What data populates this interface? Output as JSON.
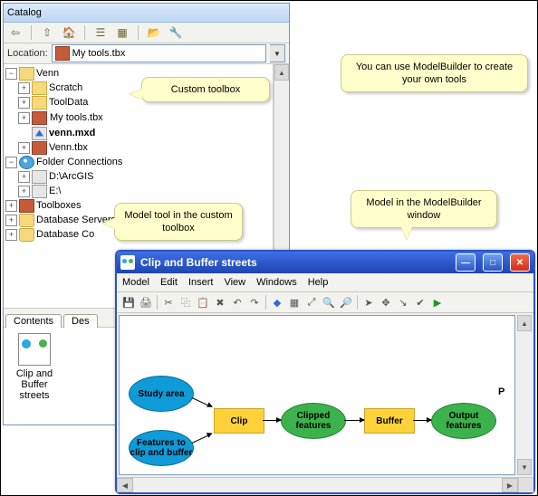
{
  "catalog": {
    "title": "Catalog",
    "location_label": "Location:",
    "location_value": "My tools.tbx",
    "tree": {
      "root": "Venn",
      "items": [
        "Scratch",
        "ToolData",
        "My tools.tbx",
        "venn.mxd",
        "Venn.tbx"
      ],
      "folder_conn": "Folder Connections",
      "conns": [
        "D:\\ArcGIS",
        "E:\\"
      ],
      "toolboxes": "Toolboxes",
      "db_servers": "Database Servers",
      "db_conn_trunc": "Database Co"
    },
    "tabs": [
      "Contents",
      "Des"
    ],
    "contents_item": "Clip and Buffer streets"
  },
  "callouts": [
    "Custom toolbox",
    "Model tool in the custom toolbox",
    "You can use ModelBuilder to create your own tools",
    "Model in the ModelBuilder window"
  ],
  "mb": {
    "title": "Clip and Buffer streets",
    "menu": [
      "Model",
      "Edit",
      "Insert",
      "View",
      "Windows",
      "Help"
    ],
    "nodes": [
      "Study area",
      "Features to clip and buffer",
      "Clip",
      "Clipped features",
      "Buffer",
      "Output features"
    ],
    "param_marker": "P"
  }
}
